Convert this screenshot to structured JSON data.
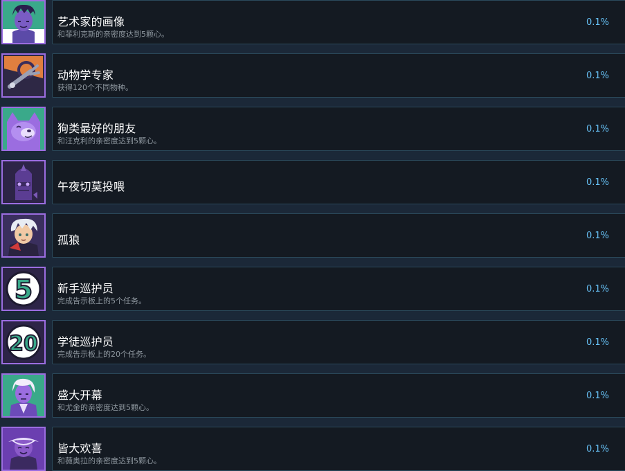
{
  "achievements": [
    {
      "title": "艺术家的画像",
      "desc": "和菲利克斯的亲密度达到5颗心。",
      "percent": "0.1%",
      "icon": "felix-portrait-icon",
      "color": "#3aa98a"
    },
    {
      "title": "动物学专家",
      "desc": "获得120个不同物种。",
      "percent": "0.1%",
      "icon": "grabber-tool-icon",
      "color": "#e07f3f"
    },
    {
      "title": "狗类最好的朋友",
      "desc": "和汪克利的亲密度达到5颗心。",
      "percent": "0.1%",
      "icon": "dog-portrait-icon",
      "color": "#3aa98a"
    },
    {
      "title": "午夜切莫投喂",
      "desc": "",
      "percent": "0.1%",
      "icon": "midnight-creature-icon",
      "color": "#5b3d93"
    },
    {
      "title": "孤狼",
      "desc": "",
      "percent": "0.1%",
      "icon": "lone-wolf-portrait-icon",
      "color": "#3a2f5e"
    },
    {
      "title": "新手巡护员",
      "desc": "完成告示板上的5个任务。",
      "percent": "0.1%",
      "icon": "number-5-icon",
      "color": "#3aa98a"
    },
    {
      "title": "学徒巡护员",
      "desc": "完成告示板上的20个任务。",
      "percent": "0.1%",
      "icon": "number-20-icon",
      "color": "#3aa98a"
    },
    {
      "title": "盛大开幕",
      "desc": "和尤金的亲密度达到5颗心。",
      "percent": "0.1%",
      "icon": "eugene-portrait-icon",
      "color": "#3aa98a"
    },
    {
      "title": "皆大欢喜",
      "desc": "和薇奥拉的亲密度达到5颗心。",
      "percent": "0.1%",
      "icon": "viola-portrait-icon",
      "color": "#6b3fb0"
    }
  ]
}
